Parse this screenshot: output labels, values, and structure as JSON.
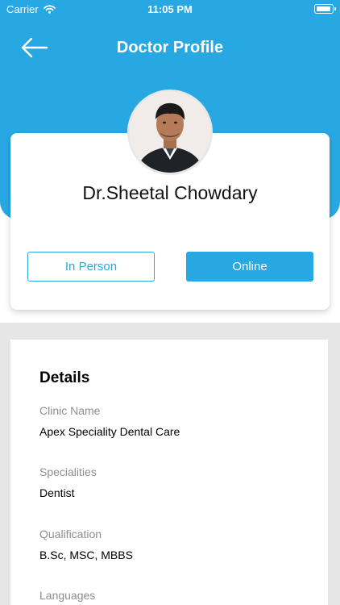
{
  "status_bar": {
    "carrier": "Carrier",
    "time": "11:05 PM"
  },
  "header": {
    "title": "Doctor Profile",
    "back_icon": "back-arrow-icon"
  },
  "profile": {
    "name": "Dr.Sheetal Chowdary",
    "consult_modes": {
      "in_person": "In Person",
      "online": "Online"
    }
  },
  "details": {
    "heading": "Details",
    "clinic_label": "Clinic Name",
    "clinic_value": "Apex Speciality Dental Care",
    "specialities_label": "Specialities",
    "specialities_value": "Dentist",
    "qualification_label": "Qualification",
    "qualification_value": "B.Sc, MSC, MBBS",
    "languages_label": "Languages"
  },
  "colors": {
    "primary": "#28a8e3",
    "page_background": "#e6e6e6",
    "card": "#ffffff"
  }
}
